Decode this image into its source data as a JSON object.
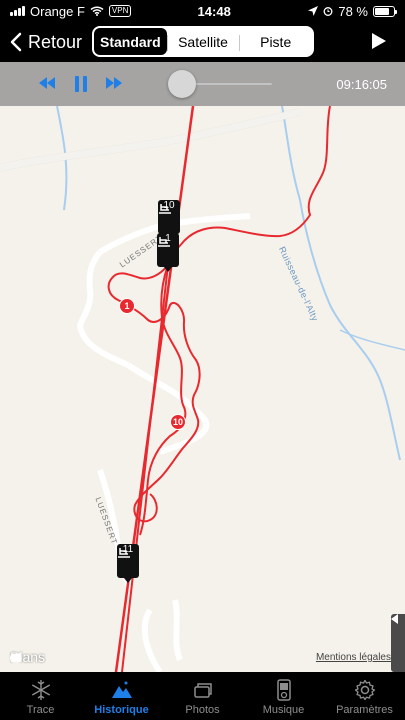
{
  "status_bar": {
    "carrier": "Orange F",
    "vpn": "VPN",
    "time": "14:48",
    "battery": "78 %",
    "battery_level": 0.78
  },
  "nav": {
    "back_label": "Retour",
    "segments": [
      "Standard",
      "Satellite",
      "Piste"
    ],
    "active_segment": "Standard"
  },
  "playback": {
    "time": "09:16:05",
    "progress": 0.0
  },
  "map": {
    "logo_text": "Plans",
    "legal_link": "Mentions légales",
    "street_labels": [
      "LUESSERT",
      "LUESSERT"
    ],
    "water_label": "Ruisseau-de-l'Alty",
    "lift_markers": [
      "10",
      "1",
      "11"
    ],
    "point_markers": [
      "1",
      "10"
    ]
  },
  "tabs": [
    {
      "label": "Trace",
      "icon": "snowflake-icon"
    },
    {
      "label": "Historique",
      "icon": "mountain-icon"
    },
    {
      "label": "Photos",
      "icon": "photos-icon"
    },
    {
      "label": "Musique",
      "icon": "music-player-icon"
    },
    {
      "label": "Paramètres",
      "icon": "gear-icon"
    }
  ],
  "active_tab": "Historique",
  "colors": {
    "accent": "#1f7fe8",
    "track": "#e8292f",
    "water": "#9fc6ea",
    "road": "#ffffff"
  }
}
